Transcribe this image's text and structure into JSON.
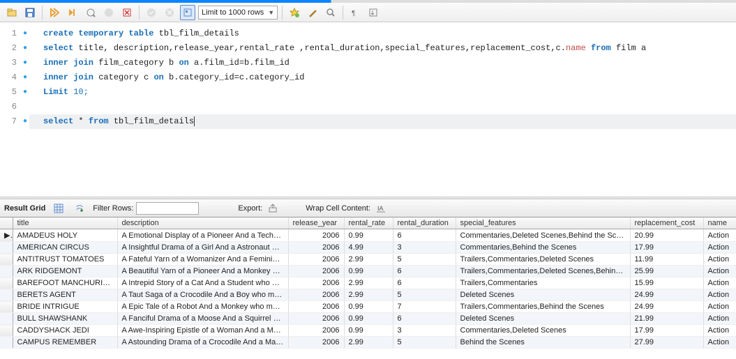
{
  "toolbar": {
    "limit_label": "Limit to 1000 rows"
  },
  "editor": {
    "lines": [
      {
        "n": 1,
        "dot": true
      },
      {
        "n": 2,
        "dot": true
      },
      {
        "n": 3,
        "dot": true
      },
      {
        "n": 4,
        "dot": true
      },
      {
        "n": 5,
        "dot": true
      },
      {
        "n": 6,
        "dot": false
      },
      {
        "n": 7,
        "dot": true,
        "active": true
      }
    ]
  },
  "code": {
    "l1_kw1": "create temporary table",
    "l1_id": " tbl_film_details",
    "l2_kw1": "select",
    "l2_rest": " title, description,release_year,rental_rate ,rental_duration,special_features,replacement_cost,c.",
    "l2_name": "name",
    "l2_from": " from",
    "l2_tbl": " film a",
    "l3_kw1": "inner join",
    "l3_tbl": " film_category b ",
    "l3_on": "on",
    "l3_cond": " a.film_id=b.film_id",
    "l4_kw1": "inner join",
    "l4_tbl": " category c ",
    "l4_on": "on",
    "l4_cond": " b.category_id=c.category_id",
    "l5_kw": "Limit",
    "l5_rest": " 10;",
    "l7_kw1": "select",
    "l7_star": " * ",
    "l7_from": "from",
    "l7_tbl": " tbl_film_details"
  },
  "resultbar": {
    "tab_label": "Result Grid",
    "filter_label": "Filter Rows:",
    "export_label": "Export:",
    "wrap_label": "Wrap Cell Content:"
  },
  "grid": {
    "headers": [
      "title",
      "description",
      "release_year",
      "rental_rate",
      "rental_duration",
      "special_features",
      "replacement_cost",
      "name"
    ],
    "rows": [
      [
        "AMADEUS HOLY",
        "A Emotional Display of a Pioneer And a Technica...",
        "2006",
        "0.99",
        "6",
        "Commentaries,Deleted Scenes,Behind the Scenes",
        "20.99",
        "Action"
      ],
      [
        "AMERICAN CIRCUS",
        "A Insightful Drama of a Girl And a Astronaut wh...",
        "2006",
        "4.99",
        "3",
        "Commentaries,Behind the Scenes",
        "17.99",
        "Action"
      ],
      [
        "ANTITRUST TOMATOES",
        "A Fateful Yarn of a Womanizer And a Feminist ...",
        "2006",
        "2.99",
        "5",
        "Trailers,Commentaries,Deleted Scenes",
        "11.99",
        "Action"
      ],
      [
        "ARK RIDGEMONT",
        "A Beautiful Yarn of a Pioneer And a Monkey wh...",
        "2006",
        "0.99",
        "6",
        "Trailers,Commentaries,Deleted Scenes,Behind t...",
        "25.99",
        "Action"
      ],
      [
        "BAREFOOT MANCHURIAN",
        "A Intrepid Story of a Cat And a Student who m...",
        "2006",
        "2.99",
        "6",
        "Trailers,Commentaries",
        "15.99",
        "Action"
      ],
      [
        "BERETS AGENT",
        "A Taut Saga of a Crocodile And a Boy who must...",
        "2006",
        "2.99",
        "5",
        "Deleted Scenes",
        "24.99",
        "Action"
      ],
      [
        "BRIDE INTRIGUE",
        "A Epic Tale of a Robot And a Monkey who must ...",
        "2006",
        "0.99",
        "7",
        "Trailers,Commentaries,Behind the Scenes",
        "24.99",
        "Action"
      ],
      [
        "BULL SHAWSHANK",
        "A Fanciful Drama of a Moose And a Squirrel who...",
        "2006",
        "0.99",
        "6",
        "Deleted Scenes",
        "21.99",
        "Action"
      ],
      [
        "CADDYSHACK JEDI",
        "A Awe-Inspiring Epistle of a Woman And a Mad...",
        "2006",
        "0.99",
        "3",
        "Commentaries,Deleted Scenes",
        "17.99",
        "Action"
      ],
      [
        "CAMPUS REMEMBER",
        "A Astounding Drama of a Crocodile And a Mad ...",
        "2006",
        "2.99",
        "5",
        "Behind the Scenes",
        "27.99",
        "Action"
      ]
    ]
  }
}
